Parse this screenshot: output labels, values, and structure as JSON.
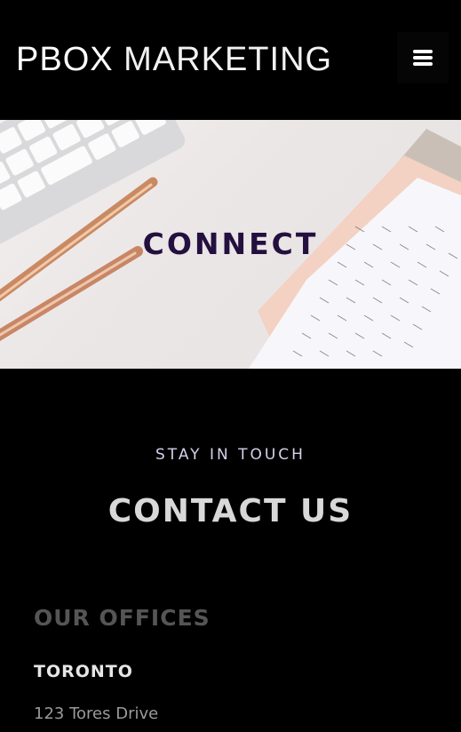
{
  "header": {
    "logo_bold": "PBOX",
    "logo_rest": " MARKETING",
    "menu_icon": "hamburger-menu-icon"
  },
  "hero": {
    "title": "CONNECT"
  },
  "contact": {
    "eyebrow": "STAY IN TOUCH",
    "heading": "CONTACT US",
    "offices_heading": "OUR OFFICES",
    "city": "TORONTO",
    "address": "123 Tores Drive"
  },
  "colors": {
    "background": "#000000",
    "hero_title": "#24103f",
    "eyebrow": "#d6d1ea",
    "heading": "#d8d8d8",
    "offices": "#555555"
  }
}
